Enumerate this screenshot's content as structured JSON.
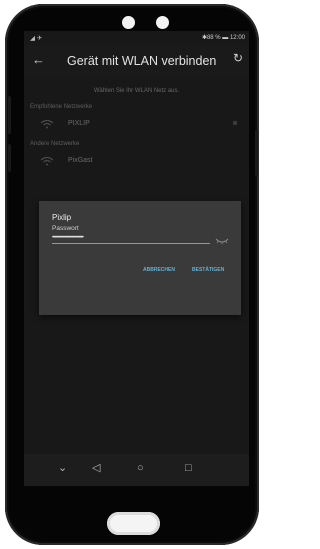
{
  "status": {
    "signal": "◢ ✈",
    "right": "✱88 % ▬ 12:00"
  },
  "appbar": {
    "title": "Gerät mit WLAN verbinden"
  },
  "hint": "Wählen Sie Ihr WLAN Netz aus.",
  "sections": {
    "recommended": "Empfohlene Netzwerke",
    "other": "Andere Netzwerke"
  },
  "networks": [
    {
      "name": "PIXLIP"
    },
    {
      "name": "PixGast"
    }
  ],
  "dialog": {
    "title": "Pixlip",
    "subtitle": "Passwort",
    "password_mask": "••••••••••••••••••••••••••••",
    "cancel": "ABBRECHEN",
    "confirm": "BESTÄTIGEN"
  }
}
